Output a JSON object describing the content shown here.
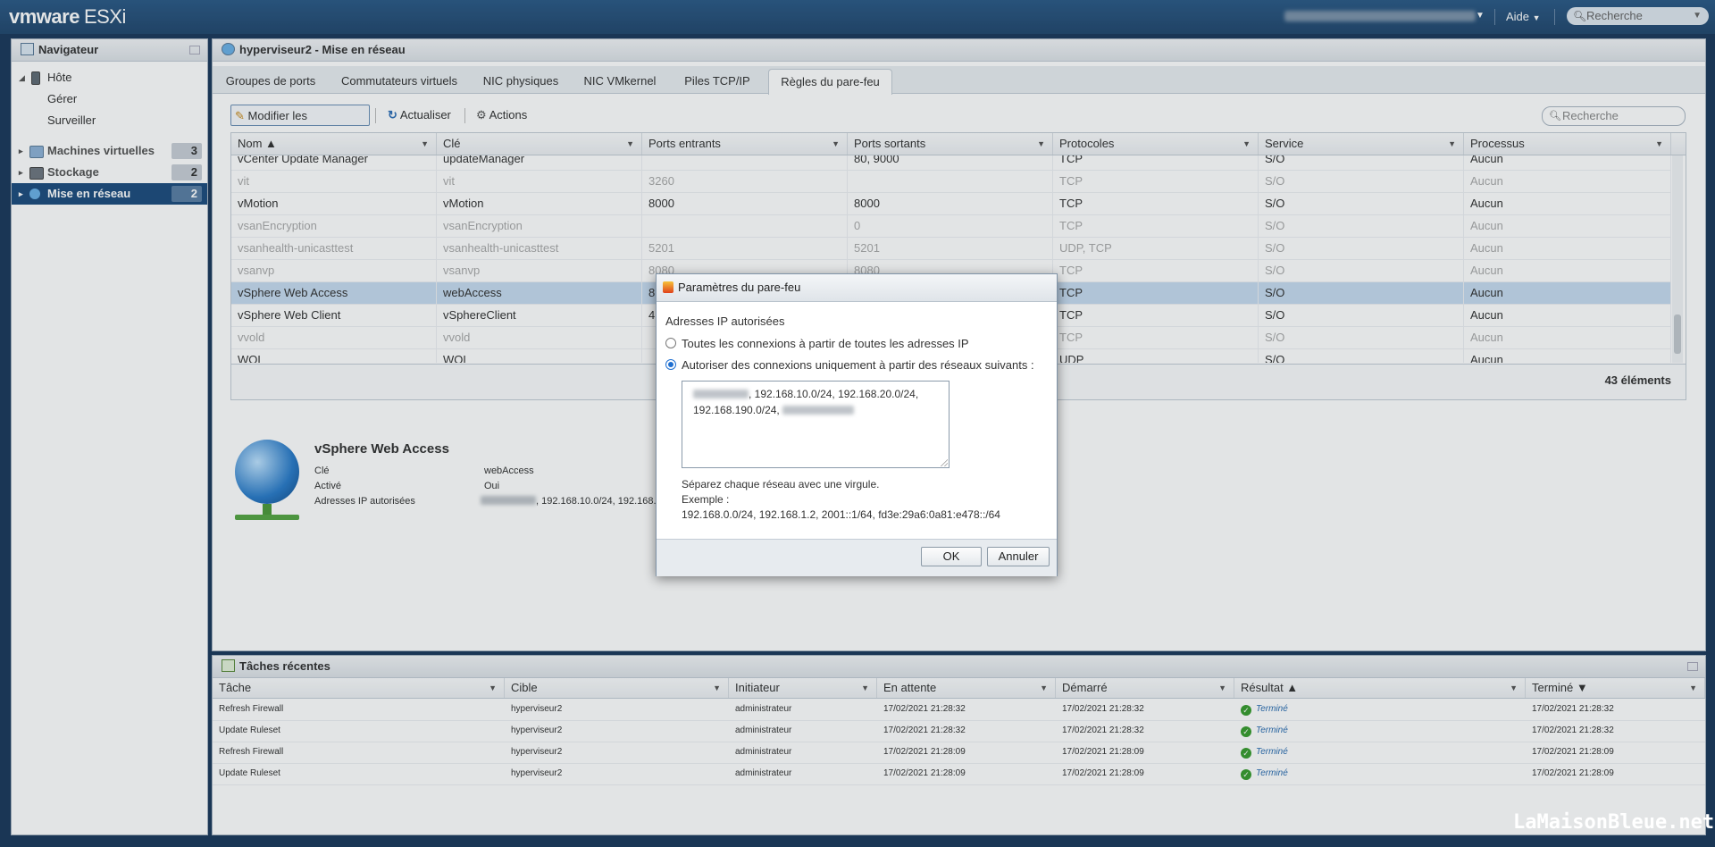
{
  "app": {
    "brand": "vmware",
    "product": "ESXi"
  },
  "topbar": {
    "help": "Aide",
    "search_placeholder": "Recherche"
  },
  "navigator": {
    "title": "Navigateur",
    "host": "Hôte",
    "host_children": [
      "Gérer",
      "Surveiller"
    ],
    "items": [
      {
        "label": "Machines virtuelles",
        "count": "3"
      },
      {
        "label": "Stockage",
        "count": "2"
      },
      {
        "label": "Mise en réseau",
        "count": "2"
      }
    ]
  },
  "main": {
    "title": "hyperviseur2 - Mise en réseau",
    "tabs": [
      "Groupes de ports",
      "Commutateurs virtuels",
      "NIC physiques",
      "NIC VMkernel",
      "Piles TCP/IP",
      "Règles du pare-feu"
    ],
    "active_tab": "Règles du pare-feu",
    "toolbar": {
      "edit": "Modifier les paramètres",
      "refresh": "Actualiser",
      "actions": "Actions"
    },
    "search_placeholder": "Recherche",
    "columns": [
      "Nom ▲",
      "Clé",
      "Ports entrants",
      "Ports sortants",
      "Protocoles",
      "Service",
      "Processus"
    ],
    "rows": [
      [
        "vCenter Update Manager",
        "updateManager",
        "",
        "80, 9000",
        "TCP",
        "S/O",
        "Aucun"
      ],
      [
        "vit",
        "vit",
        "3260",
        "",
        "TCP",
        "S/O",
        "Aucun"
      ],
      [
        "vMotion",
        "vMotion",
        "8000",
        "8000",
        "TCP",
        "S/O",
        "Aucun"
      ],
      [
        "vsanEncryption",
        "vsanEncryption",
        "",
        "0",
        "TCP",
        "S/O",
        "Aucun"
      ],
      [
        "vsanhealth-unicasttest",
        "vsanhealth-unicasttest",
        "5201",
        "5201",
        "UDP, TCP",
        "S/O",
        "Aucun"
      ],
      [
        "vsanvp",
        "vsanvp",
        "8080",
        "8080",
        "TCP",
        "S/O",
        "Aucun"
      ],
      [
        "vSphere Web Access",
        "webAccess",
        "8",
        "",
        "TCP",
        "S/O",
        "Aucun"
      ],
      [
        "vSphere Web Client",
        "vSphereClient",
        "4",
        "",
        "TCP",
        "S/O",
        "Aucun"
      ],
      [
        "vvold",
        "vvold",
        "",
        "",
        "TCP",
        "S/O",
        "Aucun"
      ],
      [
        "WOL",
        "WOL",
        "",
        "",
        "UDP",
        "S/O",
        "Aucun"
      ]
    ],
    "row_state": [
      "enabled",
      "disabled",
      "enabled",
      "disabled",
      "disabled",
      "disabled",
      "selected",
      "enabled",
      "disabled",
      "enabled"
    ],
    "count": "43 éléments",
    "details": {
      "title": "vSphere Web Access",
      "labels": [
        "Clé",
        "Activé",
        "Adresses IP autorisées"
      ],
      "key": "webAccess",
      "enabled": "Oui",
      "allowed_ips": ", 192.168.10.0/24, 192.168."
    }
  },
  "tasks": {
    "title": "Tâches récentes",
    "columns": [
      "Tâche",
      "Cible",
      "Initiateur",
      "En attente",
      "Démarré",
      "Résultat ▲",
      "Terminé ▼"
    ],
    "rows": [
      [
        "Refresh Firewall",
        "hyperviseur2",
        "administrateur",
        "17/02/2021 21:28:32",
        "17/02/2021 21:28:32",
        "Terminé",
        "17/02/2021 21:28:32"
      ],
      [
        "Update Ruleset",
        "hyperviseur2",
        "administrateur",
        "17/02/2021 21:28:32",
        "17/02/2021 21:28:32",
        "Terminé",
        "17/02/2021 21:28:32"
      ],
      [
        "Refresh Firewall",
        "hyperviseur2",
        "administrateur",
        "17/02/2021 21:28:09",
        "17/02/2021 21:28:09",
        "Terminé",
        "17/02/2021 21:28:09"
      ],
      [
        "Update Ruleset",
        "hyperviseur2",
        "administrateur",
        "17/02/2021 21:28:09",
        "17/02/2021 21:28:09",
        "Terminé",
        "17/02/2021 21:28:09"
      ]
    ]
  },
  "dialog": {
    "title": "Paramètres du pare-feu",
    "section": "Adresses IP autorisées",
    "option_all": "Toutes les connexions à partir de toutes les adresses IP",
    "option_only": "Autoriser des connexions uniquement à partir des réseaux suivants :",
    "selected_option": "only",
    "networks_line1": ", 192.168.10.0/24, 192.168.20.0/24,",
    "networks_line2": "192.168.190.0/24,",
    "help1": "Séparez chaque réseau avec une virgule.",
    "help2": "Exemple :",
    "help3": "192.168.0.0/24, 192.168.1.2, 2001::1/64, fd3e:29a6:0a81:e478::/64",
    "ok": "OK",
    "cancel": "Annuler"
  },
  "watermark": "LaMaisonBleue.net",
  "colors": {
    "topbar": "#2c5a86",
    "selected_nav": "#1e4d7e",
    "selected_row": "#c7dbef",
    "success": "#3a9d2f"
  }
}
